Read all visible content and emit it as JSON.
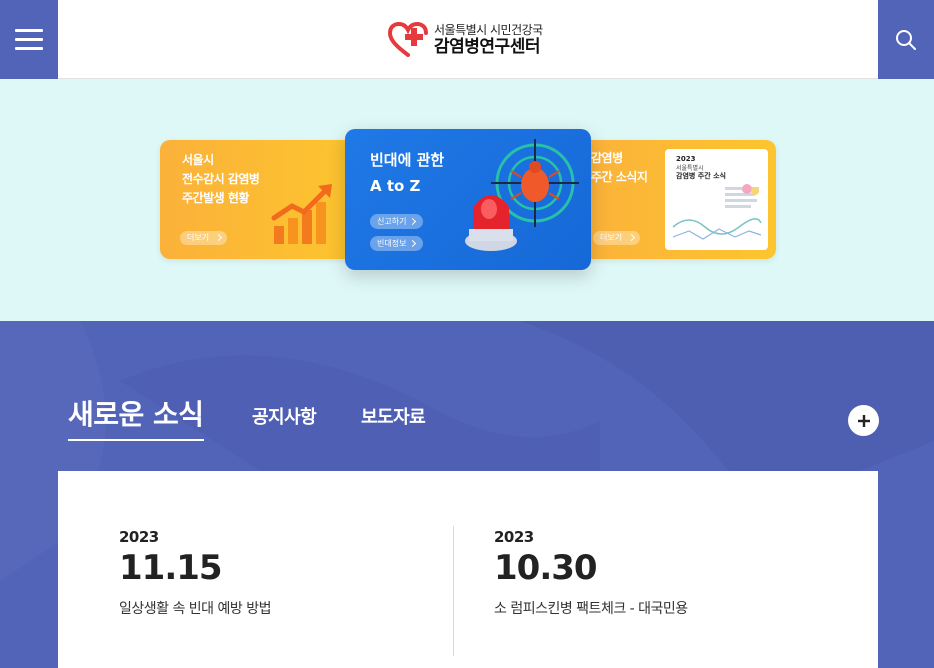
{
  "header": {
    "logo_sub": "서울특별시 시민건강국",
    "logo_main": "감염병연구센터"
  },
  "banners": {
    "left": {
      "title": "서울시\n전수감시 감염병\n주간발생 현황",
      "more": "더보기"
    },
    "center": {
      "title": "빈대에 관한\nA to Z",
      "button1": "신고하기",
      "button2": "빈대정보"
    },
    "right": {
      "title": "감염병\n주간 소식지",
      "more": "더보기",
      "report_year": "2023",
      "report_sub": "서울특별시",
      "report_title": "감염병 주간 소식"
    }
  },
  "news": {
    "active_tab": "새로운 소식",
    "tabs": [
      "공지사항",
      "보도자료"
    ],
    "items": [
      {
        "year": "2023",
        "date": "11.15",
        "title": "일상생활 속 빈대 예방 방법"
      },
      {
        "year": "2023",
        "date": "10.30",
        "title": "소 럼피스킨병 팩트체크 - 대국민용"
      }
    ]
  },
  "colors": {
    "primary": "#5264b8",
    "banner_bg": "#def7f7",
    "banner_yellow": "#fcc52e",
    "banner_blue": "#1f79e6",
    "logo_red": "#e63a3f"
  }
}
